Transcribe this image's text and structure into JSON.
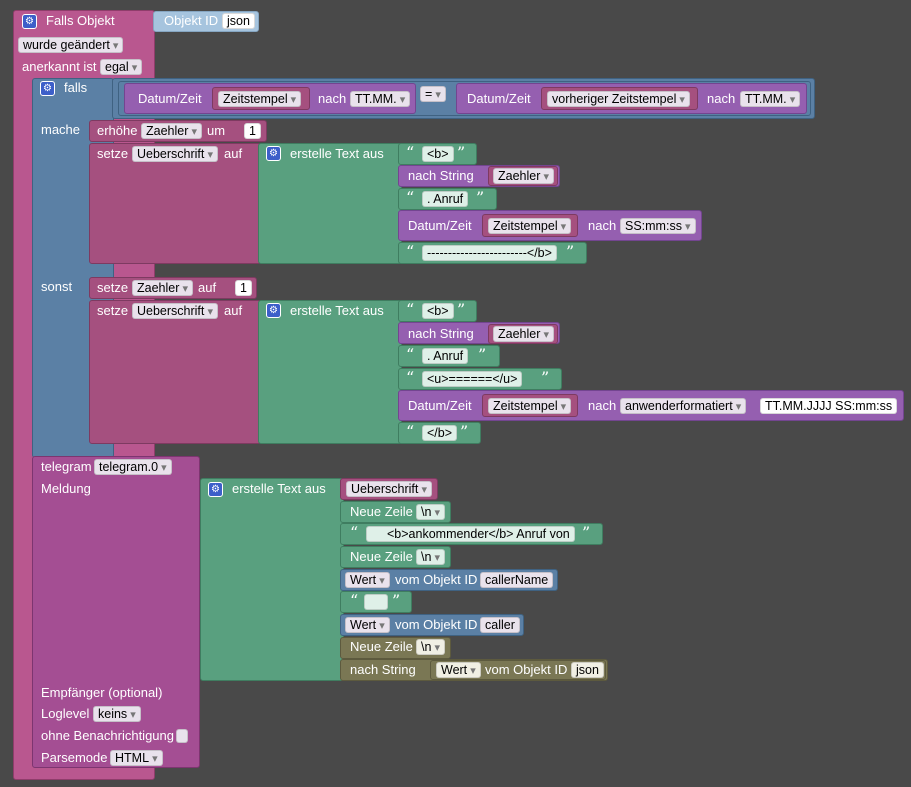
{
  "trigger": {
    "title": "Falls Objekt",
    "objid_label": "Objekt ID",
    "objid_value": "json",
    "changed": "wurde geändert",
    "ack_label": "anerkannt ist",
    "ack_value": "egal"
  },
  "if_block": {
    "if_label": "falls",
    "do_label": "mache",
    "else_label": "sonst"
  },
  "condition": {
    "date_label": "Datum/Zeit",
    "left_var": "Zeitstempel",
    "after_label": "nach",
    "left_format": "TT.MM.",
    "operator": "=",
    "right_var": "vorheriger Zeitstempel",
    "right_format": "TT.MM."
  },
  "do_branch": {
    "increment_label": "erhöhe",
    "increment_var": "Zaehler",
    "by_label": "um",
    "by_value": "1",
    "set_label": "setze",
    "set_var": "Ueberschrift",
    "to_label": "auf",
    "create_text": "erstelle Text aus",
    "items": {
      "b_open": "<b>",
      "to_string": "nach String",
      "string_var": "Zaehler",
      "call_text": ". Anruf",
      "date_label": "Datum/Zeit",
      "date_var": "Zeitstempel",
      "after_label": "nach",
      "date_format": "SS:mm:ss",
      "separator": "------------------------</b>"
    }
  },
  "else_branch": {
    "set_label": "setze",
    "counter_var": "Zaehler",
    "to_label": "auf",
    "counter_value": "1",
    "title_var": "Ueberschrift",
    "create_text": "erstelle Text aus",
    "items": {
      "b_open": "<b>",
      "to_string": "nach String",
      "string_var": "Zaehler",
      "call_text": ". Anruf",
      "underline": "<u>======</u>",
      "date_label": "Datum/Zeit",
      "date_var": "Zeitstempel",
      "after_label": "nach",
      "date_format": "anwenderformatiert",
      "custom_format": "TT.MM.JJJJ SS:mm:ss",
      "b_close": "</b>"
    }
  },
  "telegram": {
    "label": "telegram",
    "instance": "telegram.0",
    "message_label": "Meldung",
    "create_text": "erstelle Text aus",
    "items": {
      "title_var": "Ueberschrift",
      "newline_label": "Neue Zeile",
      "newline_value": "\\n",
      "caller_text": "<b>ankommender</b> Anruf von",
      "value_label": "Wert",
      "of_object": "vom Objekt ID",
      "caller_name": "callerName",
      "caller": "caller",
      "to_string": "nach String",
      "json": "json"
    },
    "recipient_label": "Empfänger (optional)",
    "loglevel_label": "Loglevel",
    "loglevel_value": "keins",
    "silent_label": "ohne Benachrichtigung",
    "parsemode_label": "Parsemode",
    "parsemode_value": "HTML"
  },
  "colors": {
    "workspace": "#494949",
    "trigger": "#b9578f",
    "control": "#5b80a5",
    "variable": "#a5507f",
    "text": "#59a07f",
    "datetime": "#955fb0",
    "telegram": "#a44e93",
    "newline": "#7a7754"
  }
}
